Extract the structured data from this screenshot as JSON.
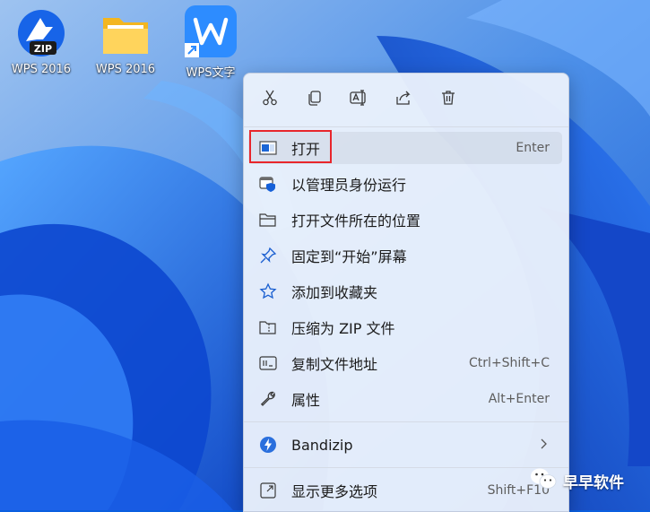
{
  "desktop": {
    "icons": [
      {
        "label": "WPS 2016",
        "icon": "zip-archive-icon"
      },
      {
        "label": "WPS 2016",
        "icon": "folder-icon"
      },
      {
        "label": "WPS文字",
        "icon": "wps-writer-icon"
      }
    ]
  },
  "context_menu": {
    "toolbar": [
      {
        "icon": "cut-icon"
      },
      {
        "icon": "copy-icon"
      },
      {
        "icon": "rename-icon"
      },
      {
        "icon": "share-icon"
      },
      {
        "icon": "delete-icon"
      }
    ],
    "items": [
      {
        "label": "打开",
        "shortcut": "Enter",
        "icon": "open-window-icon"
      },
      {
        "label": "以管理员身份运行",
        "shortcut": "",
        "icon": "admin-shield-icon"
      },
      {
        "label": "打开文件所在的位置",
        "shortcut": "",
        "icon": "folder-outline-icon"
      },
      {
        "label": "固定到“开始”屏幕",
        "shortcut": "",
        "icon": "pin-icon"
      },
      {
        "label": "添加到收藏夹",
        "shortcut": "",
        "icon": "star-icon"
      },
      {
        "label": "压缩为 ZIP 文件",
        "shortcut": "",
        "icon": "zip-folder-icon"
      },
      {
        "label": "复制文件地址",
        "shortcut": "Ctrl+Shift+C",
        "icon": "copy-path-icon"
      },
      {
        "label": "属性",
        "shortcut": "Alt+Enter",
        "icon": "wrench-icon"
      }
    ],
    "bandizip": {
      "label": "Bandizip",
      "icon": "bandizip-icon",
      "submenu": "chevron-right-icon"
    },
    "more_options": {
      "label": "显示更多选项",
      "shortcut": "Shift+F10",
      "icon": "more-options-icon"
    }
  },
  "highlight_color": "#e8262c",
  "watermark": {
    "text": "早早软件",
    "icon": "wechat-icon"
  }
}
